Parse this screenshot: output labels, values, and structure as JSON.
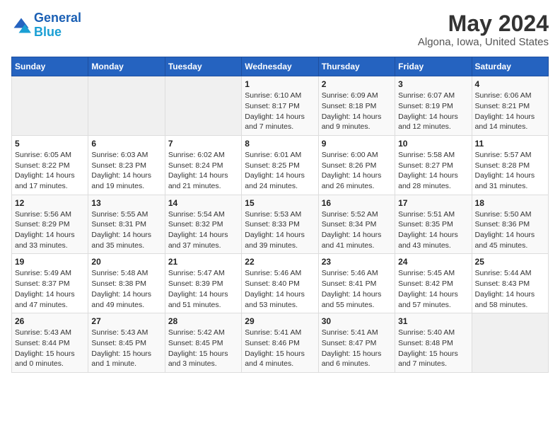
{
  "header": {
    "logo_line1": "General",
    "logo_line2": "Blue",
    "title": "May 2024",
    "subtitle": "Algona, Iowa, United States"
  },
  "weekdays": [
    "Sunday",
    "Monday",
    "Tuesday",
    "Wednesday",
    "Thursday",
    "Friday",
    "Saturday"
  ],
  "weeks": [
    [
      {
        "day": "",
        "sunrise": "",
        "sunset": "",
        "daylight": ""
      },
      {
        "day": "",
        "sunrise": "",
        "sunset": "",
        "daylight": ""
      },
      {
        "day": "",
        "sunrise": "",
        "sunset": "",
        "daylight": ""
      },
      {
        "day": "1",
        "sunrise": "Sunrise: 6:10 AM",
        "sunset": "Sunset: 8:17 PM",
        "daylight": "Daylight: 14 hours and 7 minutes."
      },
      {
        "day": "2",
        "sunrise": "Sunrise: 6:09 AM",
        "sunset": "Sunset: 8:18 PM",
        "daylight": "Daylight: 14 hours and 9 minutes."
      },
      {
        "day": "3",
        "sunrise": "Sunrise: 6:07 AM",
        "sunset": "Sunset: 8:19 PM",
        "daylight": "Daylight: 14 hours and 12 minutes."
      },
      {
        "day": "4",
        "sunrise": "Sunrise: 6:06 AM",
        "sunset": "Sunset: 8:21 PM",
        "daylight": "Daylight: 14 hours and 14 minutes."
      }
    ],
    [
      {
        "day": "5",
        "sunrise": "Sunrise: 6:05 AM",
        "sunset": "Sunset: 8:22 PM",
        "daylight": "Daylight: 14 hours and 17 minutes."
      },
      {
        "day": "6",
        "sunrise": "Sunrise: 6:03 AM",
        "sunset": "Sunset: 8:23 PM",
        "daylight": "Daylight: 14 hours and 19 minutes."
      },
      {
        "day": "7",
        "sunrise": "Sunrise: 6:02 AM",
        "sunset": "Sunset: 8:24 PM",
        "daylight": "Daylight: 14 hours and 21 minutes."
      },
      {
        "day": "8",
        "sunrise": "Sunrise: 6:01 AM",
        "sunset": "Sunset: 8:25 PM",
        "daylight": "Daylight: 14 hours and 24 minutes."
      },
      {
        "day": "9",
        "sunrise": "Sunrise: 6:00 AM",
        "sunset": "Sunset: 8:26 PM",
        "daylight": "Daylight: 14 hours and 26 minutes."
      },
      {
        "day": "10",
        "sunrise": "Sunrise: 5:58 AM",
        "sunset": "Sunset: 8:27 PM",
        "daylight": "Daylight: 14 hours and 28 minutes."
      },
      {
        "day": "11",
        "sunrise": "Sunrise: 5:57 AM",
        "sunset": "Sunset: 8:28 PM",
        "daylight": "Daylight: 14 hours and 31 minutes."
      }
    ],
    [
      {
        "day": "12",
        "sunrise": "Sunrise: 5:56 AM",
        "sunset": "Sunset: 8:29 PM",
        "daylight": "Daylight: 14 hours and 33 minutes."
      },
      {
        "day": "13",
        "sunrise": "Sunrise: 5:55 AM",
        "sunset": "Sunset: 8:31 PM",
        "daylight": "Daylight: 14 hours and 35 minutes."
      },
      {
        "day": "14",
        "sunrise": "Sunrise: 5:54 AM",
        "sunset": "Sunset: 8:32 PM",
        "daylight": "Daylight: 14 hours and 37 minutes."
      },
      {
        "day": "15",
        "sunrise": "Sunrise: 5:53 AM",
        "sunset": "Sunset: 8:33 PM",
        "daylight": "Daylight: 14 hours and 39 minutes."
      },
      {
        "day": "16",
        "sunrise": "Sunrise: 5:52 AM",
        "sunset": "Sunset: 8:34 PM",
        "daylight": "Daylight: 14 hours and 41 minutes."
      },
      {
        "day": "17",
        "sunrise": "Sunrise: 5:51 AM",
        "sunset": "Sunset: 8:35 PM",
        "daylight": "Daylight: 14 hours and 43 minutes."
      },
      {
        "day": "18",
        "sunrise": "Sunrise: 5:50 AM",
        "sunset": "Sunset: 8:36 PM",
        "daylight": "Daylight: 14 hours and 45 minutes."
      }
    ],
    [
      {
        "day": "19",
        "sunrise": "Sunrise: 5:49 AM",
        "sunset": "Sunset: 8:37 PM",
        "daylight": "Daylight: 14 hours and 47 minutes."
      },
      {
        "day": "20",
        "sunrise": "Sunrise: 5:48 AM",
        "sunset": "Sunset: 8:38 PM",
        "daylight": "Daylight: 14 hours and 49 minutes."
      },
      {
        "day": "21",
        "sunrise": "Sunrise: 5:47 AM",
        "sunset": "Sunset: 8:39 PM",
        "daylight": "Daylight: 14 hours and 51 minutes."
      },
      {
        "day": "22",
        "sunrise": "Sunrise: 5:46 AM",
        "sunset": "Sunset: 8:40 PM",
        "daylight": "Daylight: 14 hours and 53 minutes."
      },
      {
        "day": "23",
        "sunrise": "Sunrise: 5:46 AM",
        "sunset": "Sunset: 8:41 PM",
        "daylight": "Daylight: 14 hours and 55 minutes."
      },
      {
        "day": "24",
        "sunrise": "Sunrise: 5:45 AM",
        "sunset": "Sunset: 8:42 PM",
        "daylight": "Daylight: 14 hours and 57 minutes."
      },
      {
        "day": "25",
        "sunrise": "Sunrise: 5:44 AM",
        "sunset": "Sunset: 8:43 PM",
        "daylight": "Daylight: 14 hours and 58 minutes."
      }
    ],
    [
      {
        "day": "26",
        "sunrise": "Sunrise: 5:43 AM",
        "sunset": "Sunset: 8:44 PM",
        "daylight": "Daylight: 15 hours and 0 minutes."
      },
      {
        "day": "27",
        "sunrise": "Sunrise: 5:43 AM",
        "sunset": "Sunset: 8:45 PM",
        "daylight": "Daylight: 15 hours and 1 minute."
      },
      {
        "day": "28",
        "sunrise": "Sunrise: 5:42 AM",
        "sunset": "Sunset: 8:45 PM",
        "daylight": "Daylight: 15 hours and 3 minutes."
      },
      {
        "day": "29",
        "sunrise": "Sunrise: 5:41 AM",
        "sunset": "Sunset: 8:46 PM",
        "daylight": "Daylight: 15 hours and 4 minutes."
      },
      {
        "day": "30",
        "sunrise": "Sunrise: 5:41 AM",
        "sunset": "Sunset: 8:47 PM",
        "daylight": "Daylight: 15 hours and 6 minutes."
      },
      {
        "day": "31",
        "sunrise": "Sunrise: 5:40 AM",
        "sunset": "Sunset: 8:48 PM",
        "daylight": "Daylight: 15 hours and 7 minutes."
      },
      {
        "day": "",
        "sunrise": "",
        "sunset": "",
        "daylight": ""
      }
    ]
  ]
}
